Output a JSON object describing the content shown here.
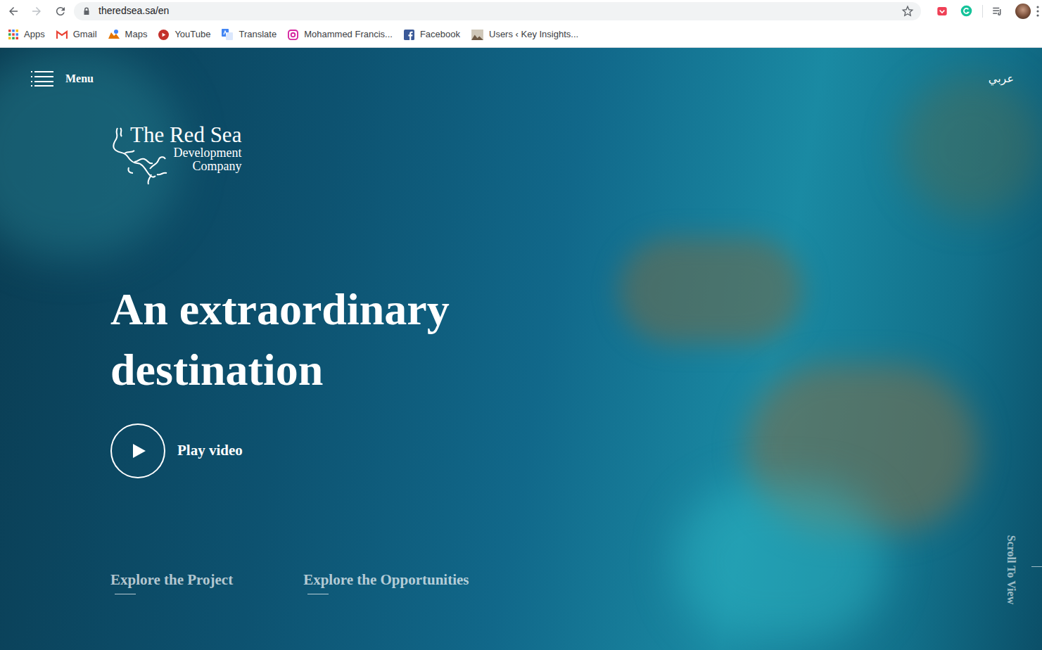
{
  "browser": {
    "url": "theredsea.sa/en",
    "bookmarks": [
      {
        "label": "Apps"
      },
      {
        "label": "Gmail"
      },
      {
        "label": "Maps"
      },
      {
        "label": "YouTube"
      },
      {
        "label": "Translate"
      },
      {
        "label": "Mohammed Francis..."
      },
      {
        "label": "Facebook"
      },
      {
        "label": "Users ‹ Key Insights..."
      }
    ]
  },
  "page": {
    "menu_label": "Menu",
    "language_toggle": "عربي",
    "logo": {
      "title": "The Red Sea",
      "line2": "Development",
      "line3": "Company"
    },
    "headline": [
      "An extraordinary",
      "destination"
    ],
    "play_label": "Play video",
    "links": [
      {
        "label": "Explore the Project"
      },
      {
        "label": "Explore the Opportunities"
      }
    ],
    "scroll_hint": "Scroll To View"
  }
}
